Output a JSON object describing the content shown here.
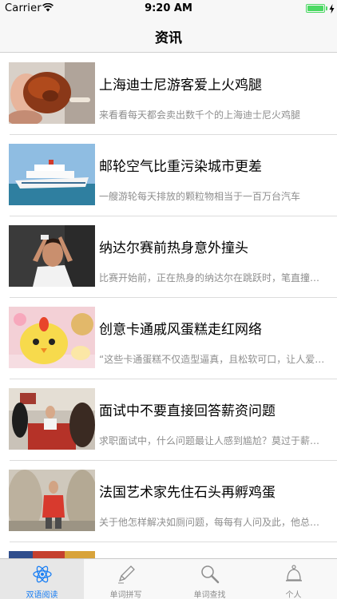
{
  "status_bar": {
    "carrier": "Carrier",
    "time": "9:20 AM",
    "battery_level": 1.0,
    "icons": [
      "wifi-icon",
      "battery-icon",
      "charging-icon"
    ]
  },
  "nav": {
    "title": "资讯"
  },
  "news": [
    {
      "title": "上海迪士尼游客爱上火鸡腿",
      "summary": "来看看每天都会卖出数千个的上海迪士尼火鸡腿",
      "image": "turkey-leg-photo"
    },
    {
      "title": "邮轮空气比重污染城市更差",
      "summary": "一艘游轮每天排放的颗粒物相当于一百万台汽车",
      "image": "cruise-ship-photo"
    },
    {
      "title": "纳达尔赛前热身意外撞头",
      "summary": "比赛开始前，正在热身的纳达尔在跳跃时，笔直撞到了头",
      "image": "tennis-player-photo"
    },
    {
      "title": "创意卡通戚风蛋糕走红网络",
      "summary": "“这些卡通蛋糕不仅造型逼真，且松软可口，让人爱不释手",
      "image": "cartoon-cake-photo"
    },
    {
      "title": "面试中不要直接回答薪资问题",
      "summary": "求职面试中，什么问题最让人感到尴尬？莫过于薪资问题",
      "image": "job-interview-photo"
    },
    {
      "title": "法国艺术家先住石头再孵鸡蛋",
      "summary": "关于他怎样解决如厕问题，每每有人问及此，他总是笑着回答",
      "image": "stone-artist-photo"
    }
  ],
  "tabs": [
    {
      "label": "双语阅读",
      "icon": "atom-icon",
      "active": true
    },
    {
      "label": "单词拼写",
      "icon": "pen-icon",
      "active": false
    },
    {
      "label": "单词查找",
      "icon": "magnifier-icon",
      "active": false
    },
    {
      "label": "个人",
      "icon": "person-bell-icon",
      "active": false
    }
  ],
  "colors": {
    "accent": "#1a7ff4",
    "battery": "#4cd964",
    "secondary_text": "#8e8e8e"
  }
}
